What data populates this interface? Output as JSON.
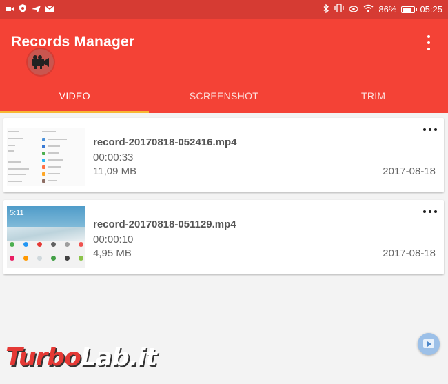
{
  "status_bar": {
    "battery": "86%",
    "time": "05:25",
    "battery_level": 0.86,
    "icons_left": [
      "video-icon",
      "shield-icon",
      "send-icon",
      "mail-icon"
    ],
    "icons_right": [
      "bluetooth-icon",
      "vibrate-icon",
      "eye-icon",
      "wifi-icon",
      "battery-icon"
    ]
  },
  "app_bar": {
    "title": "Records Manager",
    "menu_icon": "more-vert-icon",
    "floating_icon": "camera-icon",
    "colors": {
      "primary": "#f44236",
      "status": "#d63b33",
      "indicator": "#f7b733"
    }
  },
  "tabs": [
    {
      "label": "VIDEO",
      "active": true
    },
    {
      "label": "SCREENSHOT",
      "active": false
    },
    {
      "label": "TRIM",
      "active": false
    }
  ],
  "recordings": [
    {
      "filename": "record-20170818-052416.mp4",
      "duration": "00:00:33",
      "size": "11,09 MB",
      "date": "2017-08-18"
    },
    {
      "filename": "record-20170818-051129.mp4",
      "duration": "00:00:10",
      "size": "4,95 MB",
      "date": "2017-08-18"
    }
  ],
  "thumbnail2": {
    "clock": "5:11"
  },
  "fab": {
    "icon": "play-screen-icon"
  },
  "watermark": {
    "part1": "Turbo",
    "part2": "Lab.it"
  }
}
